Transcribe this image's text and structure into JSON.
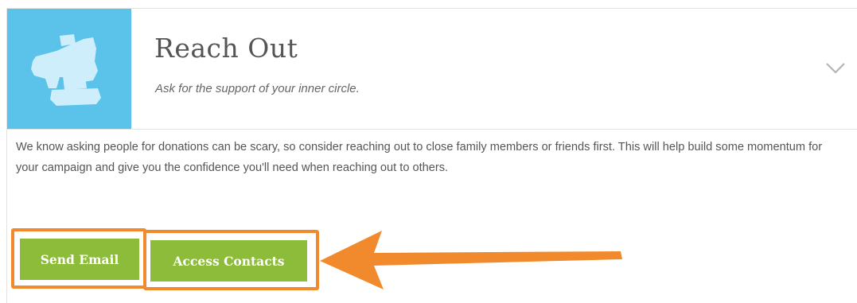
{
  "step": {
    "title": "Reach Out",
    "subtitle": "Ask for the support of your inner circle.",
    "icon": "megaphone-icon",
    "expand_icon": "chevron-down-icon",
    "description": "We know asking people for donations can be scary, so consider reaching out to close family members or friends first. This will help build some momentum for your campaign and give you the confidence you'll need when reaching out to others."
  },
  "actions": {
    "send_email_label": "Send Email",
    "access_contacts_label": "Access Contacts"
  },
  "colors": {
    "icon_tile": "#5bc3ea",
    "icon_fill": "#cfeefb",
    "button_green": "#8dbb3a",
    "annotation_orange": "#f08a2c"
  }
}
